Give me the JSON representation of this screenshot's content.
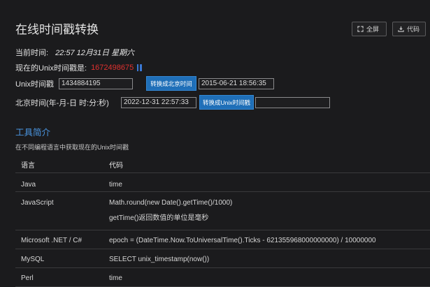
{
  "header": {
    "title": "在线时间戳转换",
    "fullscreen_label": "全屏",
    "code_label": "代码"
  },
  "current_time": {
    "label": "当前时间:",
    "value": "22:57 12月31日 星期六"
  },
  "unix_now": {
    "label": "现在的Unix时间戳是:",
    "value": "1672498675"
  },
  "unix_convert": {
    "label": "Unix时间戳",
    "input_value": "1434884195",
    "button_label": "转换成北京时间",
    "output_value": "2015-06-21 18:56:35"
  },
  "beijing_convert": {
    "label": "北京时间(年-月-日 时:分:秒)",
    "input_value": "2022-12-31 22:57:33",
    "button_label": "转换成Unix时间戳",
    "output_value": ""
  },
  "tools": {
    "title": "工具简介",
    "description": "在不同编程语言中获取现在的Unix时间戳",
    "columns": [
      "语言",
      "代码"
    ],
    "rows": [
      {
        "lang": "Java",
        "code": [
          "time"
        ]
      },
      {
        "lang": "JavaScript",
        "code": [
          "Math.round(new Date().getTime()/1000)",
          "getTime()返回数值的单位是毫秒"
        ]
      },
      {
        "lang": "Microsoft .NET / C#",
        "code": [
          "epoch = (DateTime.Now.ToUniversalTime().Ticks - 621355968000000000) / 10000000"
        ]
      },
      {
        "lang": "MySQL",
        "code": [
          "SELECT unix_timestamp(now())"
        ]
      },
      {
        "lang": "Perl",
        "code": [
          "time"
        ]
      }
    ]
  },
  "colors": {
    "accent": "#1f6fb8",
    "timestamp": "#e0312f",
    "section_title": "#4a95e0"
  }
}
